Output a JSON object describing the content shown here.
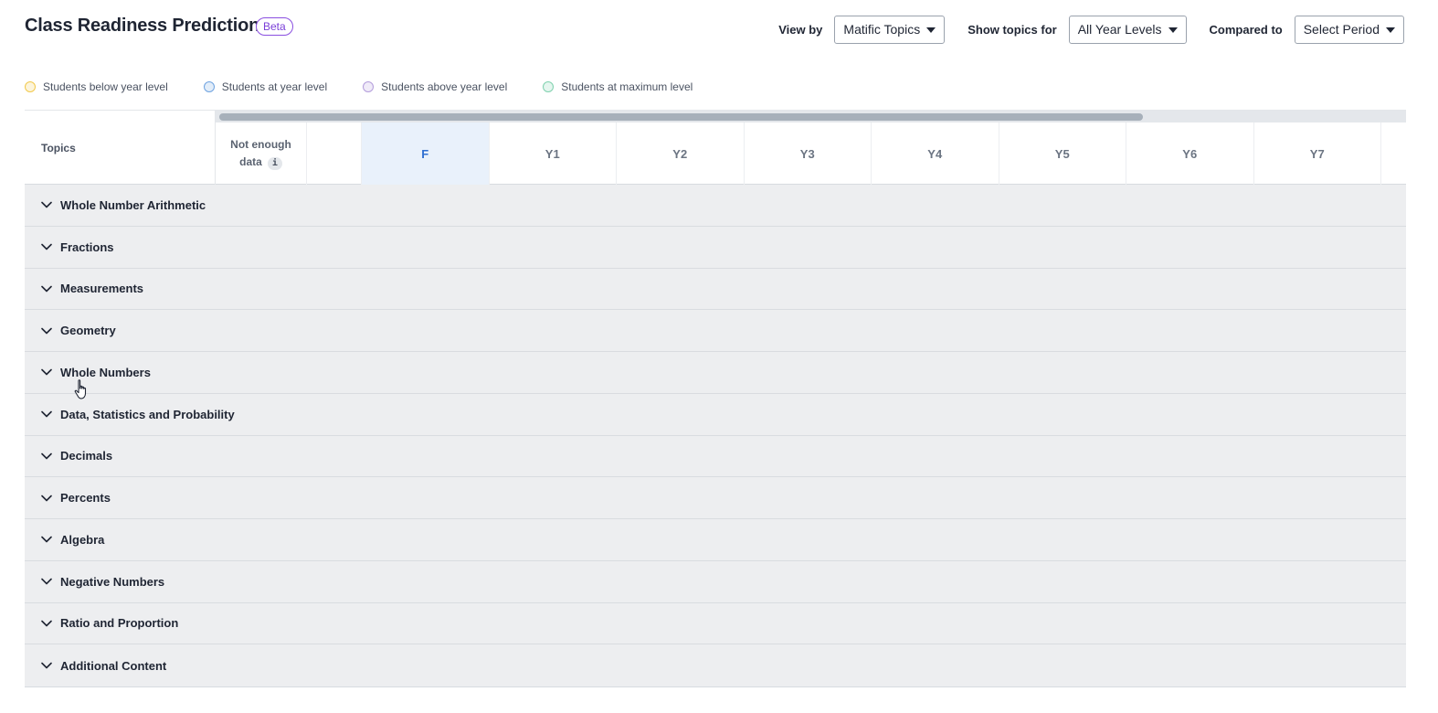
{
  "header": {
    "title": "Class Readiness Prediction",
    "badge": "Beta"
  },
  "controls": {
    "view_by": {
      "label": "View by",
      "value": "Matific Topics"
    },
    "show_topics_for": {
      "label": "Show topics for",
      "value": "All Year Levels"
    },
    "compared_to": {
      "label": "Compared to",
      "value": "Select Period"
    }
  },
  "legend": [
    {
      "label": "Students below year level",
      "color": "#f2c94c"
    },
    {
      "label": "Students at year level",
      "color": "#6fa3e0"
    },
    {
      "label": "Students above year level",
      "color": "#b39ddb"
    },
    {
      "label": "Students at maximum level",
      "color": "#7fd1ae"
    }
  ],
  "table": {
    "topics_header": "Topics",
    "not_enough_data_line1": "Not enough",
    "not_enough_data_line2": "data",
    "info_icon": "i",
    "selected_column": "F",
    "columns": [
      "F",
      "Y1",
      "Y2",
      "Y3",
      "Y4",
      "Y5",
      "Y6",
      "Y7"
    ],
    "rows": [
      "Whole Number Arithmetic",
      "Fractions",
      "Measurements",
      "Geometry",
      "Whole Numbers",
      "Data, Statistics and Probability",
      "Decimals",
      "Percents",
      "Algebra",
      "Negative Numbers",
      "Ratio and Proportion",
      "Additional Content"
    ]
  },
  "icons": {
    "row_toggle": "chevron-down-icon",
    "dropdown": "caret-down-icon",
    "cursor": "hand-pointer-icon"
  }
}
